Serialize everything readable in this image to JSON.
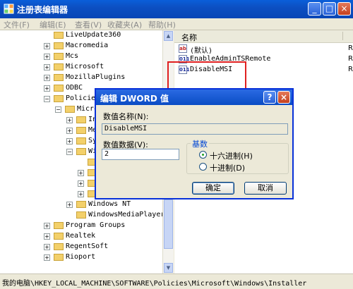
{
  "window": {
    "title": "注册表编辑器",
    "controls": {
      "minimize": "_",
      "maximize": "□",
      "close": "×"
    }
  },
  "menubar": {
    "items": [
      "文件(F)",
      "编辑(E)",
      "查看(V)",
      "收藏夹(A)",
      "帮助(H)"
    ]
  },
  "tree": {
    "items": [
      {
        "label": "LiveUpdate360",
        "expander": ""
      },
      {
        "label": "Macromedia",
        "expander": "+"
      },
      {
        "label": "Mcs",
        "expander": "+"
      },
      {
        "label": "Microsoft",
        "expander": "+"
      },
      {
        "label": "MozillaPlugins",
        "expander": "+"
      },
      {
        "label": "ODBC",
        "expander": "+"
      },
      {
        "label": "Policies",
        "expander": "−"
      },
      {
        "label": "Micro",
        "expander": "−"
      },
      {
        "label": "In",
        "expander": "+"
      },
      {
        "label": "Me",
        "expander": "+"
      },
      {
        "label": "Sy",
        "expander": "+"
      },
      {
        "label": "Wi",
        "expander": "−"
      },
      {
        "label": "",
        "expander": ""
      },
      {
        "label": "",
        "expander": "+"
      },
      {
        "label": "",
        "expander": "+"
      },
      {
        "label": "",
        "expander": "+"
      },
      {
        "label": "Windows NT",
        "expander": "+"
      },
      {
        "label": "WindowsMediaPlayer",
        "expander": ""
      },
      {
        "label": "Program Groups",
        "expander": "+"
      },
      {
        "label": "Realtek",
        "expander": "+"
      },
      {
        "label": "RegentSoft",
        "expander": "+"
      },
      {
        "label": "Rioport",
        "expander": "+"
      }
    ]
  },
  "values_pane": {
    "header_name": "名称",
    "rows": [
      {
        "icon": "ab",
        "name": "(默认)",
        "type": "R"
      },
      {
        "icon": "011",
        "name": "EnableAdminTSRemote",
        "type": "R"
      },
      {
        "icon": "011",
        "name": "DisableMSI",
        "type": "R"
      }
    ]
  },
  "dialog": {
    "title": "编辑 DWORD 值",
    "help": "?",
    "close": "×",
    "value_name_label": "数值名称(N):",
    "value_name": "DisableMSI",
    "value_data_label": "数值数据(V):",
    "value_data": "2",
    "base_label": "基数",
    "radio_hex": "十六进制(H)",
    "radio_dec": "十进制(D)",
    "selected_base": "hex",
    "ok": "确定",
    "cancel": "取消"
  },
  "status_bar": {
    "path": "我的电脑\\HKEY_LOCAL_MACHINE\\SOFTWARE\\Policies\\Microsoft\\Windows\\Installer"
  },
  "colors": {
    "title_blue": "#0a5fd9",
    "highlight_red": "#e02020",
    "folder_yellow": "#f3d06a"
  }
}
